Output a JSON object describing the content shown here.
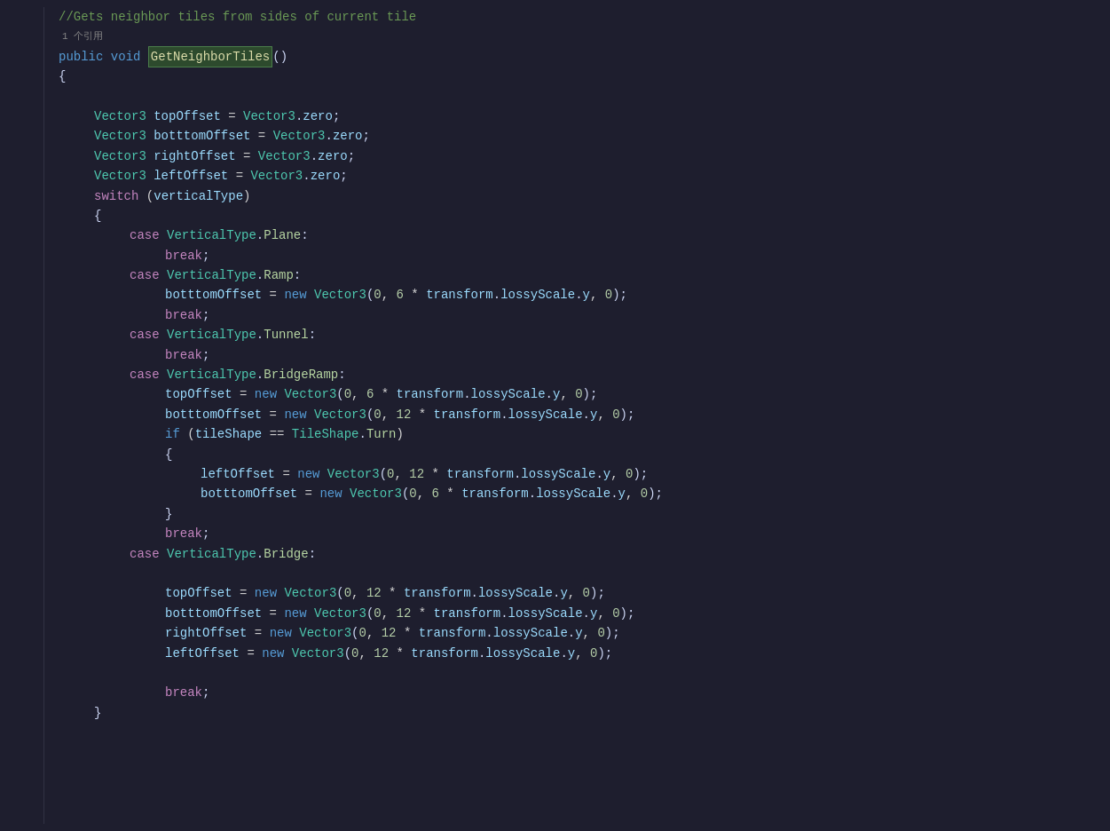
{
  "editor": {
    "background": "#1e1e2e",
    "lines": [
      {
        "num": "",
        "content": "comment",
        "text": "//Gets neighbor tiles from sides of current tile"
      },
      {
        "num": "1个引用",
        "content": "ref",
        "text": "1个引用"
      },
      {
        "num": "",
        "content": "method_def",
        "text": "public void GetNeighborTiles()"
      },
      {
        "num": "",
        "content": "brace_open",
        "text": "{"
      },
      {
        "num": "",
        "content": "empty"
      },
      {
        "num": "",
        "content": "var_decl",
        "text": "    Vector3 topOffset = Vector3.zero;"
      },
      {
        "num": "",
        "content": "var_decl",
        "text": "    Vector3 botttomOffset = Vector3.zero;"
      },
      {
        "num": "",
        "content": "var_decl",
        "text": "    Vector3 rightOffset = Vector3.zero;"
      },
      {
        "num": "",
        "content": "var_decl",
        "text": "    Vector3 leftOffset = Vector3.zero;"
      },
      {
        "num": "",
        "content": "switch",
        "text": "    switch (verticalType)"
      },
      {
        "num": "",
        "content": "brace_open",
        "text": "    {"
      },
      {
        "num": "",
        "content": "case",
        "text": "        case VerticalType.Plane:"
      },
      {
        "num": "",
        "content": "break",
        "text": "            break;"
      },
      {
        "num": "",
        "content": "case",
        "text": "        case VerticalType.Ramp:"
      },
      {
        "num": "",
        "content": "assign",
        "text": "            botttomOffset = new Vector3(0, 6 * transform.lossyScale.y, 0);"
      },
      {
        "num": "",
        "content": "break",
        "text": "            break;"
      },
      {
        "num": "",
        "content": "case",
        "text": "        case VerticalType.Tunnel:"
      },
      {
        "num": "",
        "content": "break",
        "text": "            break;"
      },
      {
        "num": "",
        "content": "case",
        "text": "        case VerticalType.BridgeRamp:"
      },
      {
        "num": "",
        "content": "assign",
        "text": "            topOffset = new Vector3(0, 6 * transform.lossyScale.y, 0);"
      },
      {
        "num": "",
        "content": "assign",
        "text": "            botttomOffset = new Vector3(0, 12 * transform.lossyScale.y, 0);"
      },
      {
        "num": "",
        "content": "if",
        "text": "            if (tileShape == TileShape.Turn)"
      },
      {
        "num": "",
        "content": "brace_open",
        "text": "            {"
      },
      {
        "num": "",
        "content": "assign_inner",
        "text": "                leftOffset = new Vector3(0, 12 * transform.lossyScale.y, 0);"
      },
      {
        "num": "",
        "content": "assign_inner",
        "text": "                botttomOffset = new Vector3(0, 6 * transform.lossyScale.y, 0);"
      },
      {
        "num": "",
        "content": "brace_close",
        "text": "            }"
      },
      {
        "num": "",
        "content": "break",
        "text": "            break;"
      },
      {
        "num": "",
        "content": "case",
        "text": "        case VerticalType.Bridge:"
      },
      {
        "num": "",
        "content": "empty"
      },
      {
        "num": "",
        "content": "assign",
        "text": "            topOffset = new Vector3(0, 12 * transform.lossyScale.y, 0);"
      },
      {
        "num": "",
        "content": "assign",
        "text": "            botttomOffset = new Vector3(0, 12 * transform.lossyScale.y, 0);"
      },
      {
        "num": "",
        "content": "assign",
        "text": "            rightOffset = new Vector3(0, 12 * transform.lossyScale.y, 0);"
      },
      {
        "num": "",
        "content": "assign",
        "text": "            leftOffset = new Vector3(0, 12 * transform.lossyScale.y, 0);"
      },
      {
        "num": "",
        "content": "empty"
      },
      {
        "num": "",
        "content": "break",
        "text": "            break;"
      },
      {
        "num": "",
        "content": "brace_close",
        "text": "    }"
      }
    ]
  }
}
